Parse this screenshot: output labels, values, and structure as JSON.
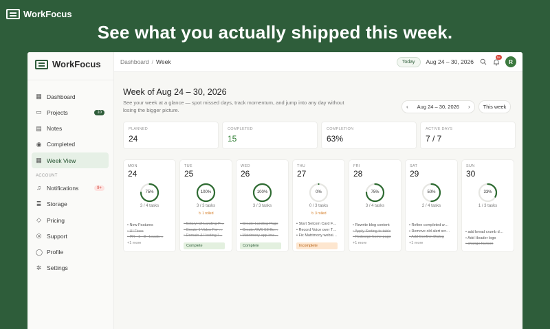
{
  "promo": {
    "brand": "WorkFocus",
    "headline": "See what you actually shipped this week."
  },
  "sidebar": {
    "brand": "WorkFocus",
    "items": [
      {
        "label": "Dashboard",
        "icon": "grid-icon"
      },
      {
        "label": "Projects",
        "icon": "folder-icon",
        "badge": "10"
      },
      {
        "label": "Notes",
        "icon": "note-icon"
      },
      {
        "label": "Completed",
        "icon": "check-circle-icon"
      },
      {
        "label": "Week View",
        "icon": "calendar-icon",
        "active": true
      }
    ],
    "account_label": "ACCOUNT",
    "account_items": [
      {
        "label": "Notifications",
        "icon": "bell-icon",
        "badge": "9+"
      },
      {
        "label": "Storage",
        "icon": "database-icon"
      },
      {
        "label": "Pricing",
        "icon": "tag-icon"
      },
      {
        "label": "Support",
        "icon": "help-icon"
      },
      {
        "label": "Profile",
        "icon": "user-icon"
      },
      {
        "label": "Settings",
        "icon": "gear-icon"
      }
    ]
  },
  "topbar": {
    "crumb_root": "Dashboard",
    "crumb_sep": "/",
    "crumb_current": "Week",
    "today_label": "Today",
    "range": "Aug 24 – 30, 2026",
    "notif_badge": "9+",
    "avatar_initial": "R"
  },
  "header": {
    "title": "Week of Aug 24 – 30, 2026",
    "subtitle": "See your week at a glance — spot missed days, track momentum, and jump into any day without losing the bigger picture.",
    "nav_range": "Aug 24 – 30, 2026",
    "prev": "‹",
    "next": "›",
    "this_week": "This week"
  },
  "stats": [
    {
      "label": "PLANNED",
      "value": "24"
    },
    {
      "label": "COMPLETED",
      "value": "15"
    },
    {
      "label": "COMPLETION",
      "value": "63%"
    },
    {
      "label": "ACTIVE DAYS",
      "value": "7 / 7"
    }
  ],
  "days": [
    {
      "name": "MON",
      "date": "24",
      "pct": 75,
      "pct_label": "75%",
      "tasks": "3 / 4 tasks",
      "rolled": "",
      "items": [
        {
          "t": "New Features",
          "done": false
        },
        {
          "t": "UI Fixes",
          "done": true
        },
        {
          "t": "PR - 1 - 8 - Loads…",
          "done": true
        }
      ],
      "more": "+1 more",
      "chip": ""
    },
    {
      "name": "TUE",
      "date": "25",
      "pct": 100,
      "pct_label": "100%",
      "tasks": "3 / 3 tasks",
      "rolled": "↻ 1 rolled",
      "items": [
        {
          "t": "Solaryi UI Landing P…",
          "done": true
        },
        {
          "t": "Create 1 Video For …",
          "done": true
        },
        {
          "t": "Domain & Hosting I…",
          "done": true
        }
      ],
      "more": "",
      "chip": "Complete",
      "chip_type": "complete"
    },
    {
      "name": "WED",
      "date": "26",
      "pct": 100,
      "pct_label": "100%",
      "tasks": "3 / 3 tasks",
      "rolled": "",
      "items": [
        {
          "t": "Create Landing Page",
          "done": true
        },
        {
          "t": "Create AWS S3 Bu…",
          "done": true
        },
        {
          "t": "Matrimony app ima…",
          "done": true
        }
      ],
      "more": "",
      "chip": "Complete",
      "chip_type": "complete"
    },
    {
      "name": "THU",
      "date": "27",
      "pct": 0,
      "pct_label": "0%",
      "tasks": "0 / 3 tasks",
      "rolled": "↻ 3 rolled",
      "items": [
        {
          "t": "Start Selcom Card F…",
          "done": false
        },
        {
          "t": "Record Voice over T…",
          "done": false
        },
        {
          "t": "Fix Matrimony websi…",
          "done": false
        }
      ],
      "more": "",
      "chip": "Incomplete",
      "chip_type": "incomplete"
    },
    {
      "name": "FRI",
      "date": "28",
      "pct": 75,
      "pct_label": "75%",
      "tasks": "3 / 4 tasks",
      "rolled": "",
      "items": [
        {
          "t": "Rewrite blog content",
          "done": false
        },
        {
          "t": "Apply Sorting to table",
          "done": true
        },
        {
          "t": "Redesign home page",
          "done": true
        }
      ],
      "more": "+1 more",
      "chip": ""
    },
    {
      "name": "SAT",
      "date": "29",
      "pct": 50,
      "pct_label": "50%",
      "tasks": "2 / 4 tasks",
      "rolled": "",
      "items": [
        {
          "t": "Refine completed w…",
          "done": false
        },
        {
          "t": "Remove old alert scr…",
          "done": false
        },
        {
          "t": "Add Confirm Dialog",
          "done": true
        }
      ],
      "more": "+1 more",
      "chip": ""
    },
    {
      "name": "SUN",
      "date": "30",
      "pct": 33,
      "pct_label": "33%",
      "tasks": "1 / 3 tasks",
      "rolled": "",
      "items": [
        {
          "t": "add bread crumb d…",
          "done": false
        },
        {
          "t": "Add Header logo",
          "done": false
        },
        {
          "t": "change favicon",
          "done": true
        }
      ],
      "more": "",
      "chip": ""
    }
  ],
  "colors": {
    "accent": "#2e5d3a",
    "ring": "#2e6b32",
    "ring_track": "#e6e6e2"
  }
}
